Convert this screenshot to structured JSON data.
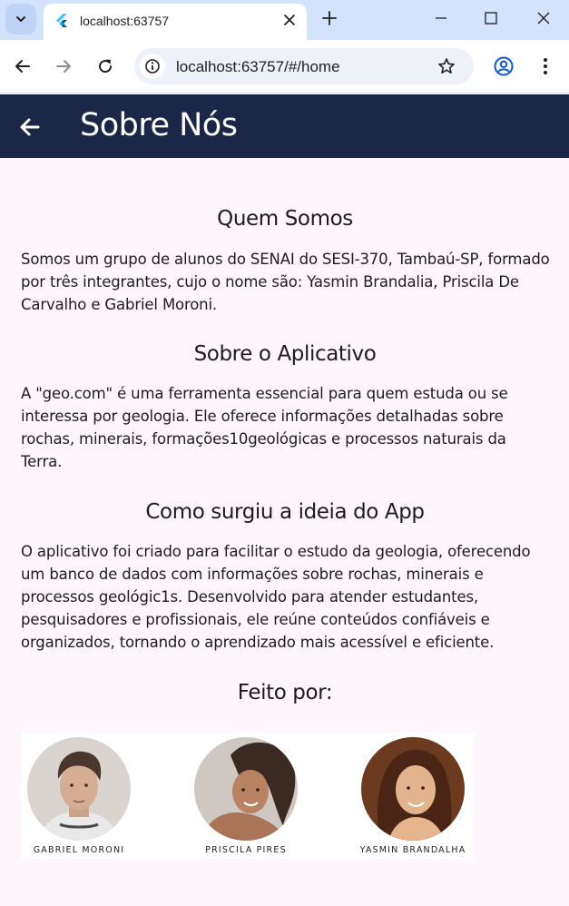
{
  "browser": {
    "tab_title": "localhost:63757",
    "url": "localhost:63757/#/home",
    "colors": {
      "tabbar": "#d3e3fd",
      "omnibox": "#eef1f8"
    }
  },
  "appbar": {
    "title": "Sobre Nós",
    "background": "#1a2746"
  },
  "sections": [
    {
      "title": "Quem Somos",
      "text": "Somos um grupo de alunos do SENAI do SESI-370, Tambaú-SP, formado por três integrantes, cujo o nome são: Yasmin Brandalia, Priscila De Carvalho e Gabriel Moroni."
    },
    {
      "title": "Sobre o Aplicativo",
      "text": "A \"geo.com\" é uma ferramenta essencial para quem estuda ou se interessa por geologia. Ele oferece informações detalhadas sobre rochas, minerais, formações10geológicas e processos naturais da Terra."
    },
    {
      "title": "Como surgiu a ideia do App",
      "text": "O aplicativo foi criado para facilitar o estudo da geologia, oferecendo um banco de dados com informações sobre rochas, minerais e processos geológic1s. Desenvolvido para atender estudantes, pesquisadores e profissionais, ele reúne conteúdos confiáveis e organizados, tornando o aprendizado mais acessível e eficiente."
    }
  ],
  "team": {
    "title": "Feito por:",
    "members": [
      {
        "name": "GABRIEL MORONI"
      },
      {
        "name": "PRISCILA PIRES"
      },
      {
        "name": "YASMIN BRANDALHA"
      }
    ]
  }
}
